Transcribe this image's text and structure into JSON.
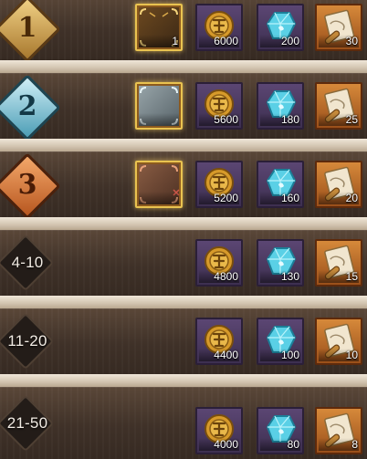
{
  "rewards": [
    {
      "rank": "1",
      "badge": "gold",
      "frame_reward": "1",
      "coin": "6000",
      "gem": "200",
      "scroll": "30"
    },
    {
      "rank": "2",
      "badge": "ice",
      "coin": "5600",
      "gem": "180",
      "scroll": "25"
    },
    {
      "rank": "3",
      "badge": "bronze",
      "coin": "5200",
      "gem": "160",
      "scroll": "20"
    },
    {
      "rank": "4-10",
      "badge": "dark",
      "coin": "4800",
      "gem": "130",
      "scroll": "15"
    },
    {
      "rank": "11-20",
      "badge": "dark",
      "coin": "4400",
      "gem": "100",
      "scroll": "10"
    },
    {
      "rank": "21-50",
      "badge": "dark",
      "coin": "4000",
      "gem": "80",
      "scroll": "8"
    }
  ],
  "icons": {
    "frame": "avatar-frame-icon",
    "coin": "gold-coin-icon",
    "gem": "blue-gem-icon",
    "scroll": "scroll-icon"
  },
  "colors": {
    "row_bg": "#3f3128",
    "separator": "#e6dccd",
    "coin_tile": "#4b3a62",
    "scroll_tile": "#c06f2a",
    "frame_border": "#e9c350"
  }
}
